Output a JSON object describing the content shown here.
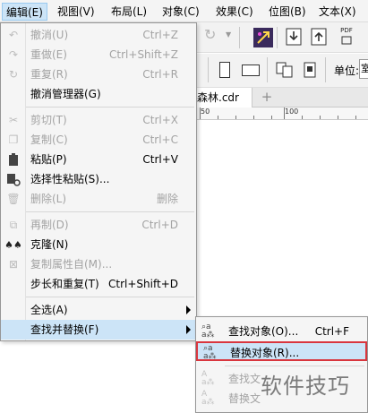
{
  "menubar": {
    "items": [
      {
        "label": "编辑(E)",
        "active": true
      },
      {
        "label": "视图(V)"
      },
      {
        "label": "布局(L)"
      },
      {
        "label": "对象(C)"
      },
      {
        "label": "效果(C)"
      },
      {
        "label": "位图(B)"
      },
      {
        "label": "文本(X)"
      }
    ]
  },
  "toolbar": {
    "pdf_label": "PDF",
    "unit_label": "单位:",
    "unit_value": "室"
  },
  "document": {
    "tab_label": "森林.cdr",
    "add_tab": "+",
    "ruler_labels": [
      "50",
      "100"
    ]
  },
  "edit_menu": {
    "items": [
      {
        "label": "撤消(U)",
        "shortcut": "Ctrl+Z",
        "disabled": true,
        "icon": "undo-icon"
      },
      {
        "label": "重做(E)",
        "shortcut": "Ctrl+Shift+Z",
        "disabled": true,
        "icon": "redo-icon"
      },
      {
        "label": "重复(R)",
        "shortcut": "Ctrl+R",
        "disabled": true,
        "icon": "repeat-icon"
      },
      {
        "label": "撤消管理器(G)",
        "shortcut": "",
        "disabled": false,
        "icon": ""
      },
      {
        "label": "剪切(T)",
        "shortcut": "Ctrl+X",
        "disabled": true,
        "icon": "cut-icon"
      },
      {
        "label": "复制(C)",
        "shortcut": "Ctrl+C",
        "disabled": true,
        "icon": "copy-icon"
      },
      {
        "label": "粘贴(P)",
        "shortcut": "Ctrl+V",
        "disabled": false,
        "icon": "paste-icon"
      },
      {
        "label": "选择性粘贴(S)...",
        "shortcut": "",
        "disabled": false,
        "icon": "paste-special-icon"
      },
      {
        "label": "删除(L)",
        "shortcut": "删除",
        "disabled": true,
        "icon": "delete-icon"
      },
      {
        "label": "再制(D)",
        "shortcut": "Ctrl+D",
        "disabled": true,
        "icon": "duplicate-icon"
      },
      {
        "label": "克隆(N)",
        "shortcut": "",
        "disabled": false,
        "icon": "clone-icon"
      },
      {
        "label": "复制属性自(M)...",
        "shortcut": "",
        "disabled": true,
        "icon": "copy-properties-icon"
      },
      {
        "label": "步长和重复(T)",
        "shortcut": "Ctrl+Shift+D",
        "disabled": false,
        "icon": ""
      },
      {
        "label": "全选(A)",
        "shortcut": "",
        "disabled": false,
        "icon": "",
        "submenu": true
      },
      {
        "label": "查找并替换(F)",
        "shortcut": "",
        "disabled": false,
        "icon": "",
        "submenu": true,
        "hover": true
      }
    ]
  },
  "find_submenu": {
    "items": [
      {
        "label": "查找对象(O)...",
        "shortcut": "Ctrl+F",
        "disabled": false,
        "icon": "find-objects-icon"
      },
      {
        "label": "替换对象(R)...",
        "shortcut": "",
        "disabled": false,
        "icon": "replace-objects-icon",
        "selected": true
      },
      {
        "label": "查找文",
        "shortcut": "",
        "disabled": true,
        "icon": "find-text-icon"
      },
      {
        "label": "替换文",
        "shortcut": "",
        "disabled": true,
        "icon": "replace-text-icon"
      }
    ]
  },
  "watermark": "软件技巧",
  "colors": {
    "highlight": "#cce4f7",
    "selection_outline": "#d9363e",
    "disabled_text": "#a3a3a3"
  }
}
